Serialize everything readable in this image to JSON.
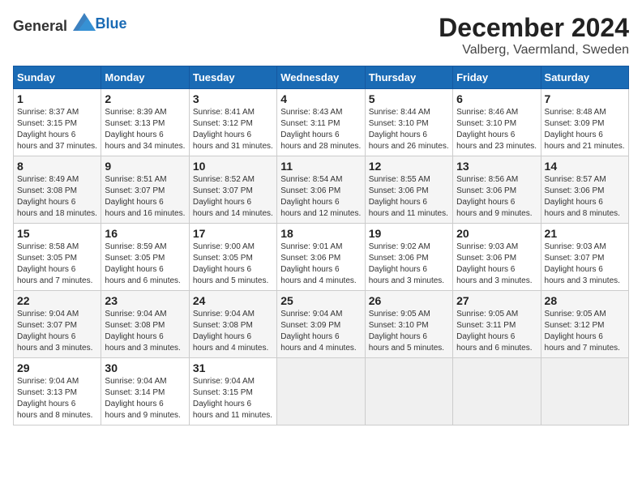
{
  "header": {
    "logo_general": "General",
    "logo_blue": "Blue",
    "title": "December 2024",
    "subtitle": "Valberg, Vaermland, Sweden"
  },
  "calendar": {
    "days_of_week": [
      "Sunday",
      "Monday",
      "Tuesday",
      "Wednesday",
      "Thursday",
      "Friday",
      "Saturday"
    ],
    "weeks": [
      [
        {
          "day": "1",
          "sunrise": "8:37 AM",
          "sunset": "3:15 PM",
          "daylight": "6 hours and 37 minutes."
        },
        {
          "day": "2",
          "sunrise": "8:39 AM",
          "sunset": "3:13 PM",
          "daylight": "6 hours and 34 minutes."
        },
        {
          "day": "3",
          "sunrise": "8:41 AM",
          "sunset": "3:12 PM",
          "daylight": "6 hours and 31 minutes."
        },
        {
          "day": "4",
          "sunrise": "8:43 AM",
          "sunset": "3:11 PM",
          "daylight": "6 hours and 28 minutes."
        },
        {
          "day": "5",
          "sunrise": "8:44 AM",
          "sunset": "3:10 PM",
          "daylight": "6 hours and 26 minutes."
        },
        {
          "day": "6",
          "sunrise": "8:46 AM",
          "sunset": "3:10 PM",
          "daylight": "6 hours and 23 minutes."
        },
        {
          "day": "7",
          "sunrise": "8:48 AM",
          "sunset": "3:09 PM",
          "daylight": "6 hours and 21 minutes."
        }
      ],
      [
        {
          "day": "8",
          "sunrise": "8:49 AM",
          "sunset": "3:08 PM",
          "daylight": "6 hours and 18 minutes."
        },
        {
          "day": "9",
          "sunrise": "8:51 AM",
          "sunset": "3:07 PM",
          "daylight": "6 hours and 16 minutes."
        },
        {
          "day": "10",
          "sunrise": "8:52 AM",
          "sunset": "3:07 PM",
          "daylight": "6 hours and 14 minutes."
        },
        {
          "day": "11",
          "sunrise": "8:54 AM",
          "sunset": "3:06 PM",
          "daylight": "6 hours and 12 minutes."
        },
        {
          "day": "12",
          "sunrise": "8:55 AM",
          "sunset": "3:06 PM",
          "daylight": "6 hours and 11 minutes."
        },
        {
          "day": "13",
          "sunrise": "8:56 AM",
          "sunset": "3:06 PM",
          "daylight": "6 hours and 9 minutes."
        },
        {
          "day": "14",
          "sunrise": "8:57 AM",
          "sunset": "3:06 PM",
          "daylight": "6 hours and 8 minutes."
        }
      ],
      [
        {
          "day": "15",
          "sunrise": "8:58 AM",
          "sunset": "3:05 PM",
          "daylight": "6 hours and 7 minutes."
        },
        {
          "day": "16",
          "sunrise": "8:59 AM",
          "sunset": "3:05 PM",
          "daylight": "6 hours and 6 minutes."
        },
        {
          "day": "17",
          "sunrise": "9:00 AM",
          "sunset": "3:05 PM",
          "daylight": "6 hours and 5 minutes."
        },
        {
          "day": "18",
          "sunrise": "9:01 AM",
          "sunset": "3:06 PM",
          "daylight": "6 hours and 4 minutes."
        },
        {
          "day": "19",
          "sunrise": "9:02 AM",
          "sunset": "3:06 PM",
          "daylight": "6 hours and 3 minutes."
        },
        {
          "day": "20",
          "sunrise": "9:03 AM",
          "sunset": "3:06 PM",
          "daylight": "6 hours and 3 minutes."
        },
        {
          "day": "21",
          "sunrise": "9:03 AM",
          "sunset": "3:07 PM",
          "daylight": "6 hours and 3 minutes."
        }
      ],
      [
        {
          "day": "22",
          "sunrise": "9:04 AM",
          "sunset": "3:07 PM",
          "daylight": "6 hours and 3 minutes."
        },
        {
          "day": "23",
          "sunrise": "9:04 AM",
          "sunset": "3:08 PM",
          "daylight": "6 hours and 3 minutes."
        },
        {
          "day": "24",
          "sunrise": "9:04 AM",
          "sunset": "3:08 PM",
          "daylight": "6 hours and 4 minutes."
        },
        {
          "day": "25",
          "sunrise": "9:04 AM",
          "sunset": "3:09 PM",
          "daylight": "6 hours and 4 minutes."
        },
        {
          "day": "26",
          "sunrise": "9:05 AM",
          "sunset": "3:10 PM",
          "daylight": "6 hours and 5 minutes."
        },
        {
          "day": "27",
          "sunrise": "9:05 AM",
          "sunset": "3:11 PM",
          "daylight": "6 hours and 6 minutes."
        },
        {
          "day": "28",
          "sunrise": "9:05 AM",
          "sunset": "3:12 PM",
          "daylight": "6 hours and 7 minutes."
        }
      ],
      [
        {
          "day": "29",
          "sunrise": "9:04 AM",
          "sunset": "3:13 PM",
          "daylight": "6 hours and 8 minutes."
        },
        {
          "day": "30",
          "sunrise": "9:04 AM",
          "sunset": "3:14 PM",
          "daylight": "6 hours and 9 minutes."
        },
        {
          "day": "31",
          "sunrise": "9:04 AM",
          "sunset": "3:15 PM",
          "daylight": "6 hours and 11 minutes."
        },
        null,
        null,
        null,
        null
      ]
    ]
  }
}
